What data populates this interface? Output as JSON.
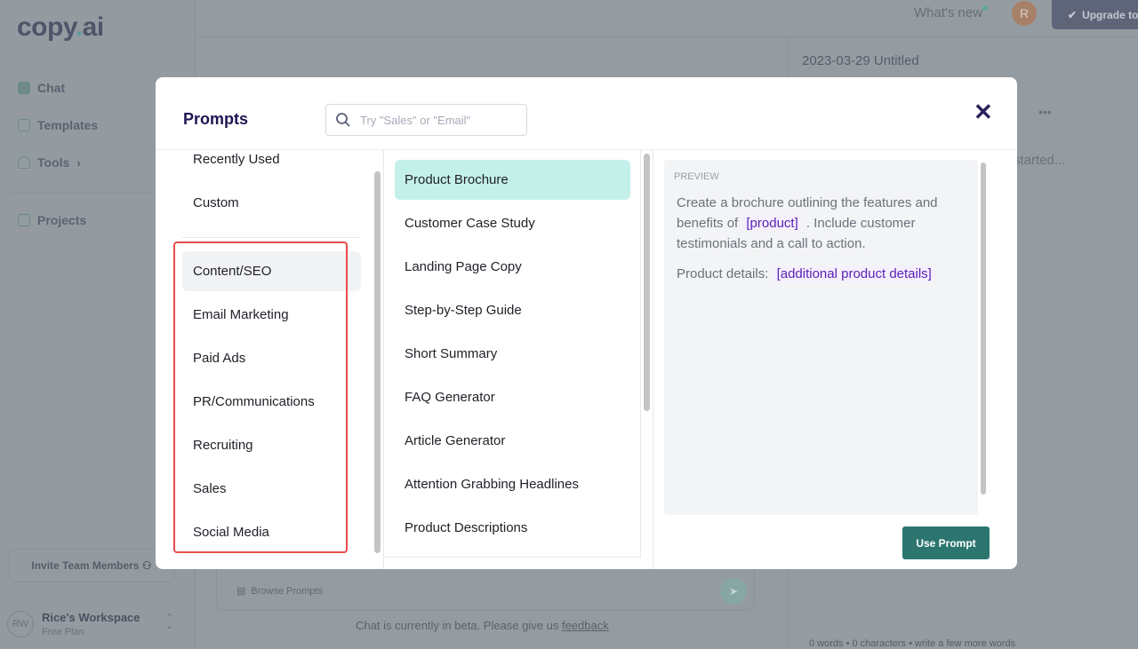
{
  "app": {
    "logo": "copy.ai",
    "logo_main": "copy",
    "logo_dot": ".",
    "logo_end": "ai"
  },
  "sidebar": {
    "items": [
      {
        "label": "Chat"
      },
      {
        "label": "Templates"
      },
      {
        "label": "Tools",
        "chevron": "›"
      },
      {
        "label": "Projects"
      }
    ],
    "invite_label": "Invite Team Members",
    "workspace": {
      "initials": "RW",
      "name": "Rice's Workspace",
      "plan": "Free Plan"
    }
  },
  "topbar": {
    "whats_new": "What's new",
    "avatar_initial": "R",
    "upgrade_label": "Upgrade to"
  },
  "document": {
    "title": "2023-03-29 Untitled",
    "placeholder": "started...",
    "stats": {
      "words": "0 words",
      "characters": "0 characters",
      "hint": "write a few more words"
    }
  },
  "chat": {
    "browse_prompts": "Browse Prompts",
    "beta_text": "Chat is currently in beta. Please give us ",
    "feedback_link": "feedback"
  },
  "modal": {
    "title": "Prompts",
    "search_placeholder": "Try \"Sales\" or \"Email\"",
    "close": "✕",
    "categories_top": [
      "Recently Used",
      "Custom"
    ],
    "categories": [
      "Content/SEO",
      "Email Marketing",
      "Paid Ads",
      "PR/Communications",
      "Recruiting",
      "Sales",
      "Social Media"
    ],
    "selected_category": "Content/SEO",
    "prompts": [
      "Product Brochure",
      "Customer Case Study",
      "Landing Page Copy",
      "Step-by-Step Guide",
      "Short Summary",
      "FAQ Generator",
      "Article Generator",
      "Attention Grabbing Headlines",
      "Product Descriptions"
    ],
    "selected_prompt": "Product Brochure",
    "preview": {
      "label": "PREVIEW",
      "p1a": "Create a brochure outlining the features and benefits of ",
      "var1": "[product]",
      "p1b": " . Include customer testimonials and a call to action.",
      "p2a": "Product details: ",
      "var2": "[additional product details]"
    },
    "use_button": "Use Prompt"
  }
}
